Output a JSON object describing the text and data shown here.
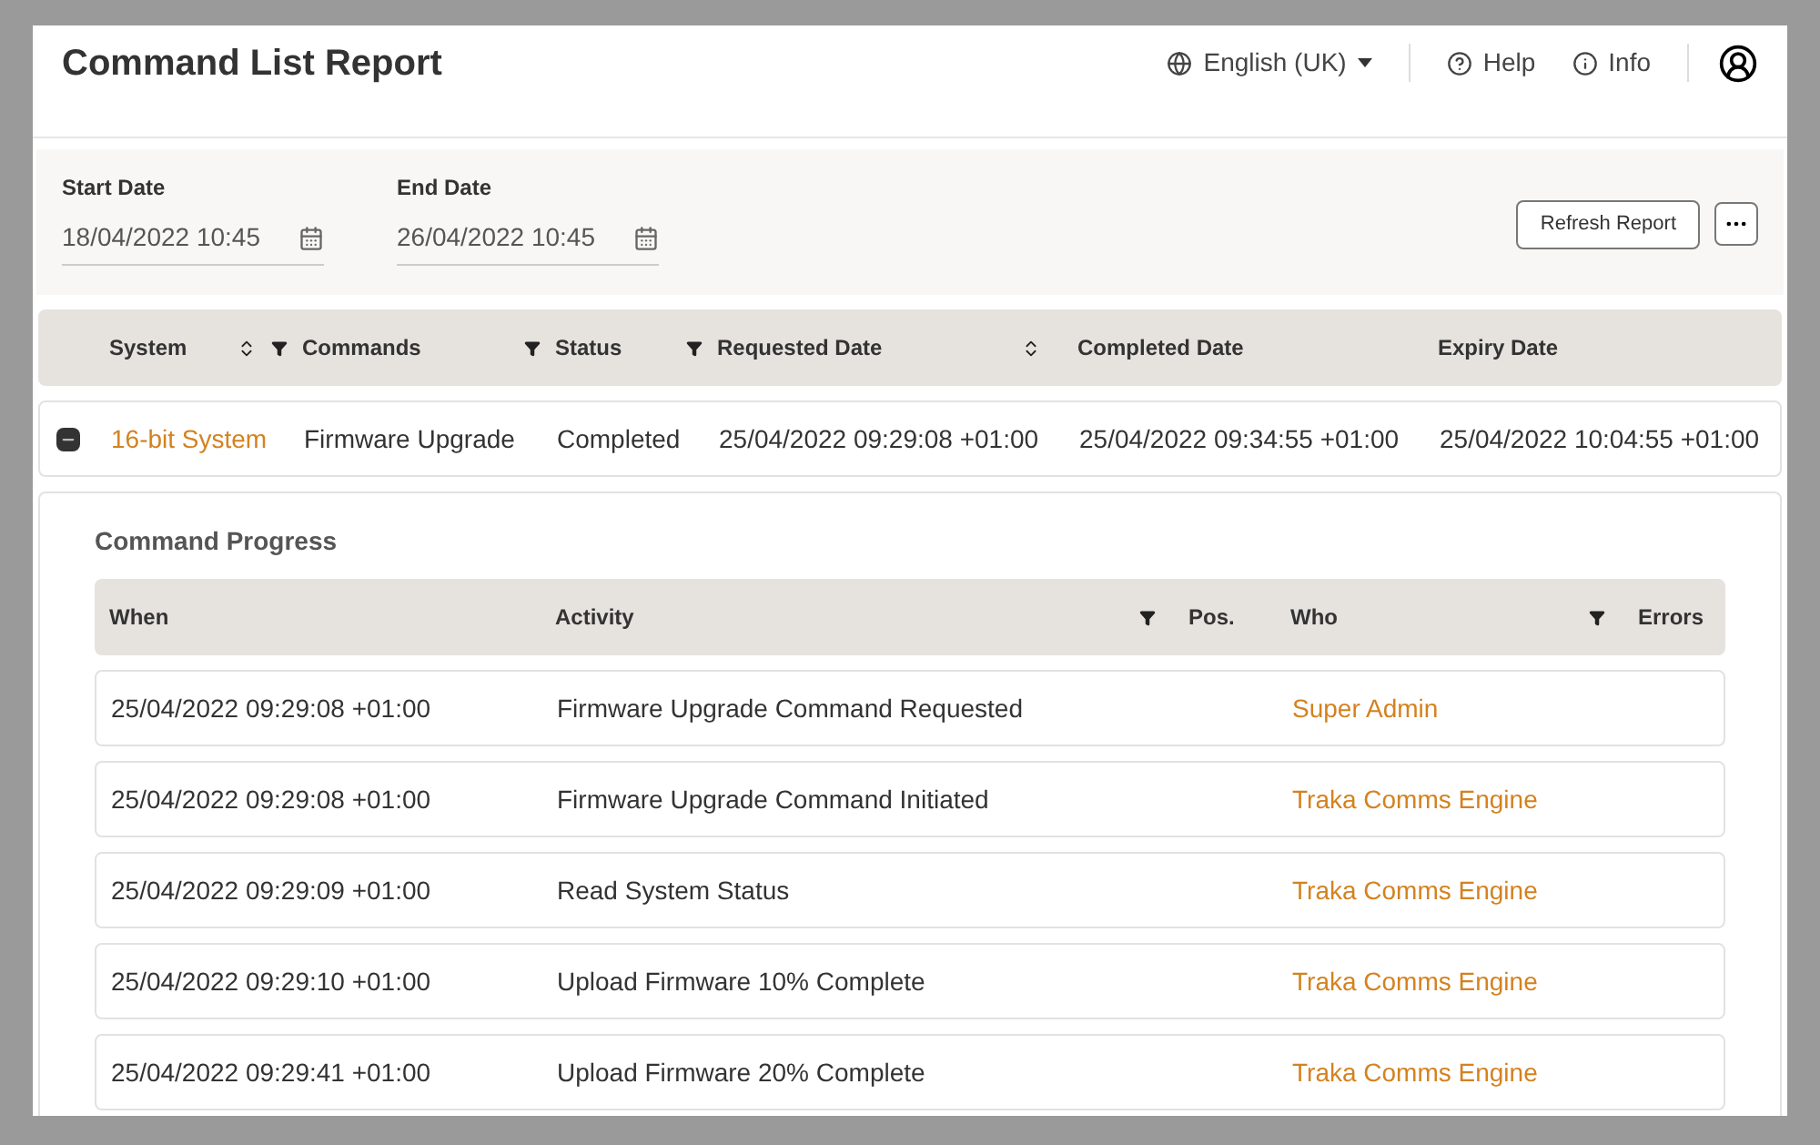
{
  "title": "Command List Report",
  "header": {
    "language": "English (UK)",
    "help": "Help",
    "info": "Info"
  },
  "filters": {
    "start": {
      "label": "Start Date",
      "value": "18/04/2022 10:45"
    },
    "end": {
      "label": "End Date",
      "value": "26/04/2022 10:45"
    },
    "refresh": "Refresh Report"
  },
  "table": {
    "columns": [
      {
        "label": "System",
        "sortable": true,
        "filterable": true
      },
      {
        "label": "Commands",
        "sortable": false,
        "filterable": true
      },
      {
        "label": "Status",
        "sortable": false,
        "filterable": true
      },
      {
        "label": "Requested Date",
        "sortable": true,
        "filterable": false
      },
      {
        "label": "Completed Date",
        "sortable": false,
        "filterable": false
      },
      {
        "label": "Expiry Date",
        "sortable": false,
        "filterable": false
      }
    ],
    "rows": [
      {
        "expanded": true,
        "cells": [
          "16-bit System",
          "Firmware Upgrade",
          "Completed",
          "25/04/2022 09:29:08 +01:00",
          "25/04/2022 09:34:55 +01:00",
          "25/04/2022 10:04:55 +01:00"
        ]
      }
    ]
  },
  "progress": {
    "title": "Command Progress",
    "columns": [
      {
        "label": "When",
        "filterable": false
      },
      {
        "label": "Activity",
        "filterable": true
      },
      {
        "label": "Pos.",
        "filterable": false
      },
      {
        "label": "Who",
        "filterable": true
      },
      {
        "label": "Errors",
        "filterable": false
      }
    ],
    "rows": [
      {
        "when": "25/04/2022 09:29:08 +01:00",
        "activity": "Firmware Upgrade Command Requested",
        "who": "Super Admin"
      },
      {
        "when": "25/04/2022 09:29:08 +01:00",
        "activity": "Firmware Upgrade Command Initiated",
        "who": "Traka Comms Engine"
      },
      {
        "when": "25/04/2022 09:29:09 +01:00",
        "activity": "Read System Status",
        "who": "Traka Comms Engine"
      },
      {
        "when": "25/04/2022 09:29:10 +01:00",
        "activity": "Upload Firmware 10% Complete",
        "who": "Traka Comms Engine"
      },
      {
        "when": "25/04/2022 09:29:41 +01:00",
        "activity": "Upload Firmware 20% Complete",
        "who": "Traka Comms Engine"
      }
    ]
  }
}
